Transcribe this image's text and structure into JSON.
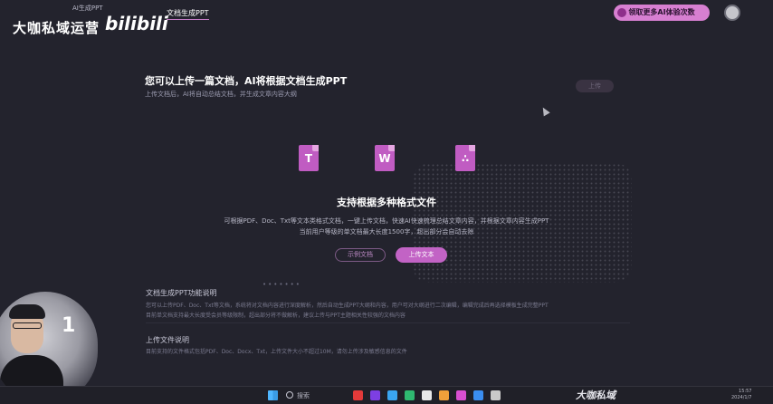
{
  "brand": {
    "title": "大咖私域运营",
    "logo": "bilibili",
    "sub": "AI生成PPT"
  },
  "header": {
    "doc_tab": "文档生成PPT",
    "experience_button": "领取更多AI体验次数"
  },
  "upload": {
    "title": "您可以上传一篇文档，AI将根据文档生成PPT",
    "subtitle": "上传文档后，AI将自动总结文档，并生成文章内容大纲",
    "ghost_button": "上传"
  },
  "formats": {
    "icons": [
      "T",
      "W",
      "PDF"
    ],
    "title": "支持根据多种格式文件",
    "desc_line1": "可根据PDF、Doc、Txt等文本类格式文档，一键上传文档，快速AI快速梳理总结文章内容，并根据文章内容生成PPT",
    "desc_line2": "当前用户等级的单文档最大长度1500字，超出部分会自动去除",
    "outline_button": "示例文档",
    "upload_button": "上传文本"
  },
  "sections": {
    "sec1_title": "文档生成PPT功能说明",
    "sec1_line1": "您可以上传PDF、Doc、Txt等文档，系统将对文档内容进行深度解析，然后自动生成PPT大纲和内容，用户可对大纲进行二次编辑，编辑完成后再选择模板生成完整PPT",
    "sec1_line2": "目前单文档支持最大长度受会员等级限制，超出部分将不做解析，建议上传与PPT主题相关性较强的文档内容",
    "sec2_title": "上传文件说明",
    "sec2_line1": "目前支持的文件格式包括PDF、Doc、Docx、Txt，上传文件大小不超过10M，请勿上传涉及敏感信息的文件"
  },
  "webcam": {
    "badge": "1"
  },
  "taskbar": {
    "search": "搜索",
    "watermark": "大咖私域",
    "time": "15:57",
    "date": "2024/1/7",
    "app_colors": [
      "#e23a3a",
      "#7d3fe3",
      "#3aa5f0",
      "#2fb870",
      "#e9e9e9",
      "#f0a03a",
      "#d84fd0",
      "#3a8ef0",
      "#c9c9c9"
    ]
  }
}
